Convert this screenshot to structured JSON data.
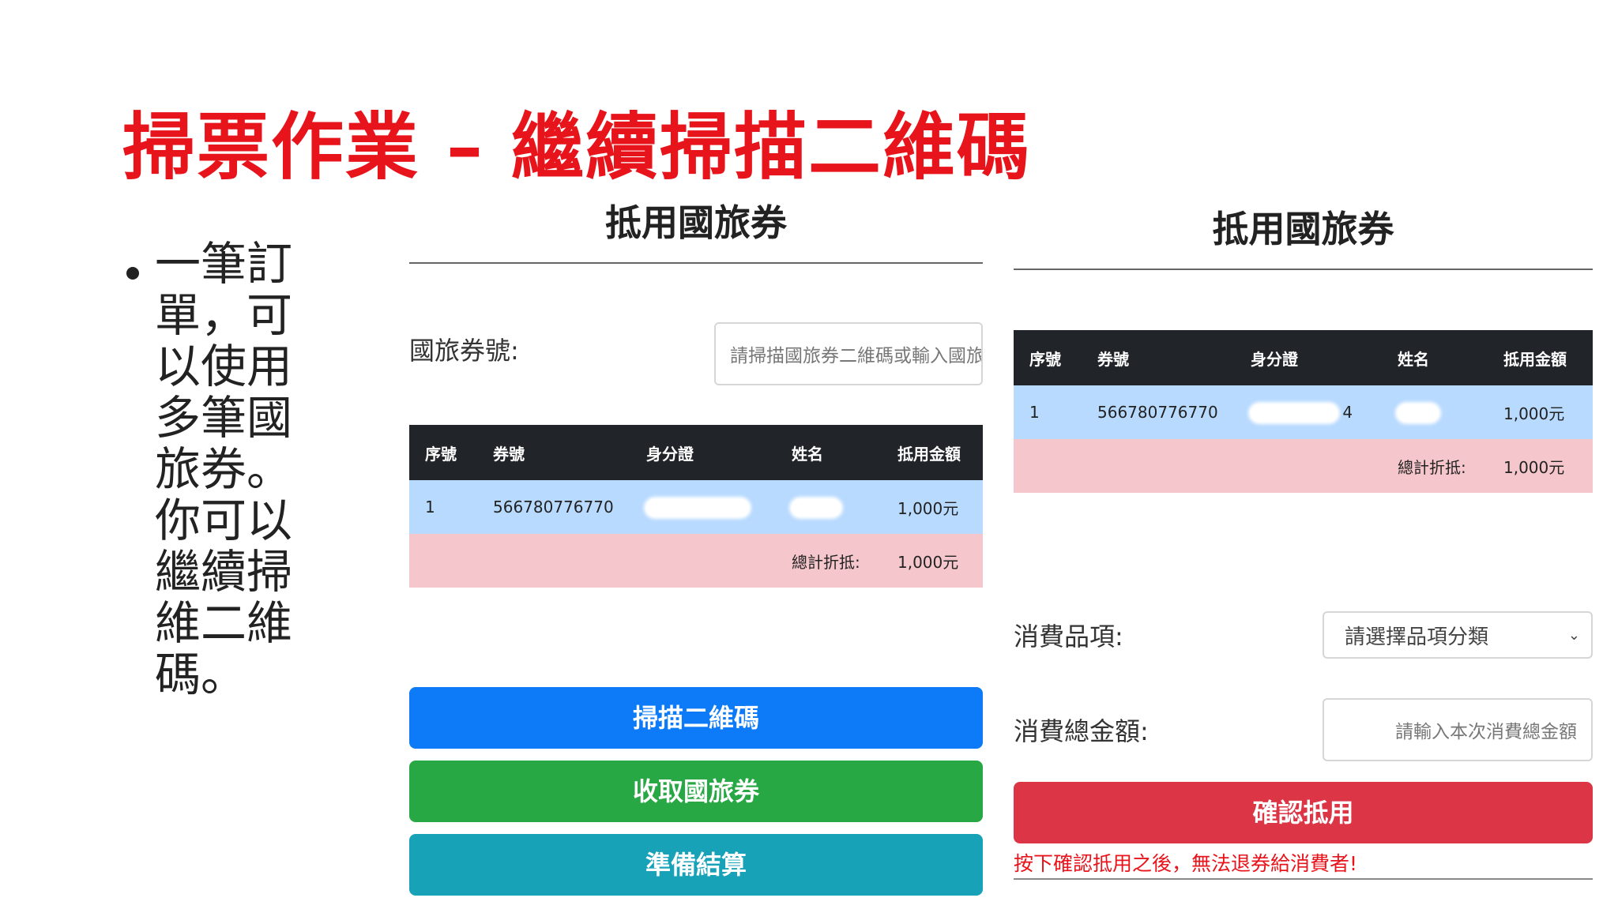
{
  "slide": {
    "title": "掃票作業 – 繼續掃描二維碼",
    "bullet": "一筆訂單，可以使用多筆國旅券。你可以繼續掃維二維碼。"
  },
  "left_panel": {
    "heading": "抵用國旅券",
    "voucher_label": "國旅券號:",
    "voucher_placeholder": "請掃描國旅券二維碼或輸入國旅",
    "table": {
      "headers": [
        "序號",
        "券號",
        "身分證",
        "姓名",
        "抵用金額"
      ],
      "row": {
        "index": "1",
        "code": "566780776770",
        "amount": "1,000元"
      },
      "total_label": "總計折抵:",
      "total_amount": "1,000元"
    },
    "buttons": {
      "scan": "掃描二維碼",
      "collect": "收取國旅券",
      "checkout": "準備結算"
    }
  },
  "right_panel": {
    "heading": "抵用國旅券",
    "table": {
      "headers": [
        "序號",
        "券號",
        "身分證",
        "姓名",
        "抵用金額"
      ],
      "row": {
        "index": "1",
        "code": "566780776770",
        "id_tail": "4",
        "amount": "1,000元"
      },
      "total_label": "總計折抵:",
      "total_amount": "1,000元"
    },
    "category_label": "消費品項:",
    "category_select": "請選擇品項分類",
    "total_label": "消費總金額:",
    "total_placeholder": "請輸入本次消費總金額",
    "confirm_button": "確認抵用",
    "warning": "按下確認抵用之後，無法退券給消費者!"
  },
  "colors": {
    "title_red": "#e8141b",
    "table_header": "#212529",
    "row_blue": "#b8daff",
    "row_pink": "#f5c6cb",
    "btn_blue": "#0d7bf7",
    "btn_green": "#28a745",
    "btn_teal": "#17a2b8",
    "btn_red": "#dc3545"
  },
  "icons": {
    "select_arrow": "chevron-down-icon"
  }
}
